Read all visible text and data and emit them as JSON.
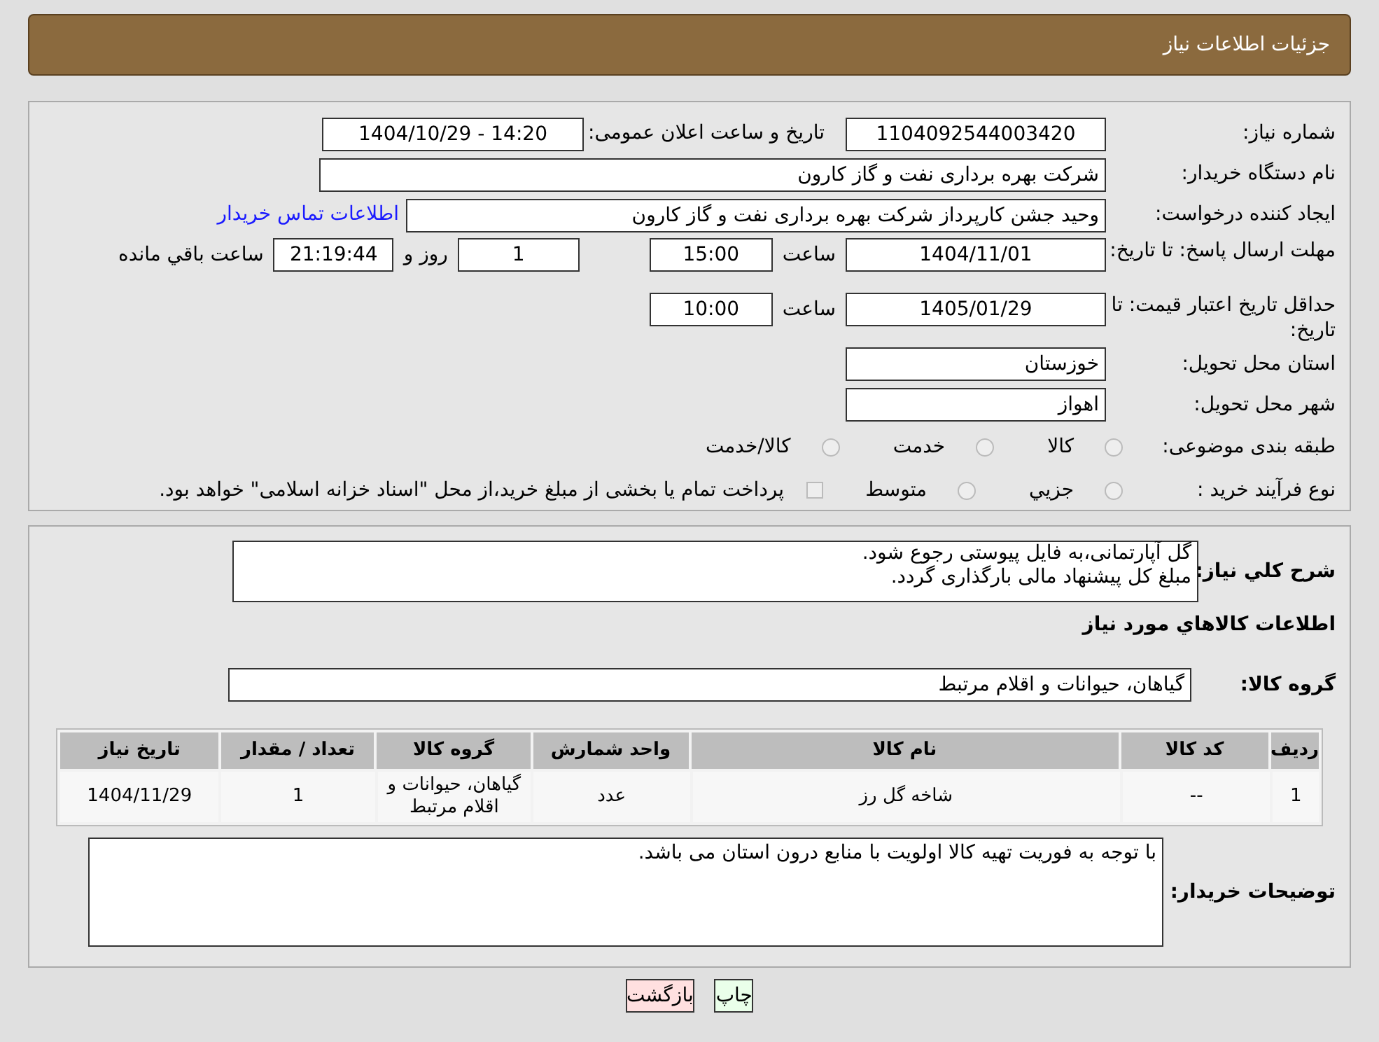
{
  "header": {
    "title": "جزئیات اطلاعات نیاز"
  },
  "need_number": {
    "label": "شماره نیاز:",
    "value": "1104092544003420"
  },
  "announce": {
    "label": "تاریخ و ساعت اعلان عمومی:",
    "value": "1404/10/29 - 14:20"
  },
  "buyer_org": {
    "label": "نام دستگاه خریدار:",
    "value": "شرکت بهره برداری نفت و گاز کارون"
  },
  "creator": {
    "label": "ایجاد کننده درخواست:",
    "value": "وحید جشن کارپرداز شرکت بهره برداری نفت و گاز کارون",
    "link": "اطلاعات تماس خریدار"
  },
  "reply_deadline": {
    "label": "مهلت ارسال پاسخ: تا تاریخ:",
    "date": "1404/11/01",
    "time_label": "ساعت",
    "time": "15:00",
    "days": "1",
    "days_label": "روز و",
    "remaining": "21:19:44",
    "remaining_label": "ساعت باقي مانده"
  },
  "price_validity": {
    "label": "حداقل تاریخ اعتبار قیمت: تا تاریخ:",
    "date": "1405/01/29",
    "time_label": "ساعت",
    "time": "10:00"
  },
  "province": {
    "label": "استان محل تحویل:",
    "value": "خوزستان"
  },
  "city": {
    "label": "شهر محل تحویل:",
    "value": "اهواز"
  },
  "category": {
    "label": "طبقه بندی موضوعی:",
    "options": [
      {
        "label": "کالا",
        "selected": false
      },
      {
        "label": "خدمت",
        "selected": false
      },
      {
        "label": "کالا/خدمت",
        "selected": false
      }
    ]
  },
  "purchase_type": {
    "label": "نوع فرآیند خرید :",
    "options": [
      {
        "label": "جزيي",
        "selected": false
      },
      {
        "label": "متوسط",
        "selected": false
      }
    ],
    "note": "پرداخت تمام یا بخشی از مبلغ خرید،از محل \"اسناد خزانه اسلامی\" خواهد بود."
  },
  "description": {
    "label": "شرح كلي نياز:",
    "lines": [
      "گل آپارتمانی،به فایل پیوستی رجوع شود.",
      "مبلغ کل پیشنهاد مالی بارگذاری گردد."
    ]
  },
  "goods_title": "اطلاعات كالاهاي مورد نياز",
  "goods_group": {
    "label": "گروه کالا:",
    "value": "گیاهان، حیوانات و اقلام مرتبط"
  },
  "table": {
    "columns": [
      "ردیف",
      "کد کالا",
      "نام کالا",
      "واحد شمارش",
      "گروه کالا",
      "تعداد / مقدار",
      "تاریخ نیاز"
    ],
    "rows": [
      [
        "1",
        "--",
        "شاخه گل رز",
        "عدد",
        "گیاهان، حیوانات و اقلام مرتبط",
        "1",
        "1404/11/29"
      ]
    ]
  },
  "buyer_notes": {
    "label": "توضیحات خریدار:",
    "value": "با توجه به فوریت تهیه کالا اولویت با منابع درون استان می باشد."
  },
  "buttons": [
    {
      "label": "چاپ",
      "kind": "print"
    },
    {
      "label": "بازگشت",
      "kind": "back"
    }
  ]
}
